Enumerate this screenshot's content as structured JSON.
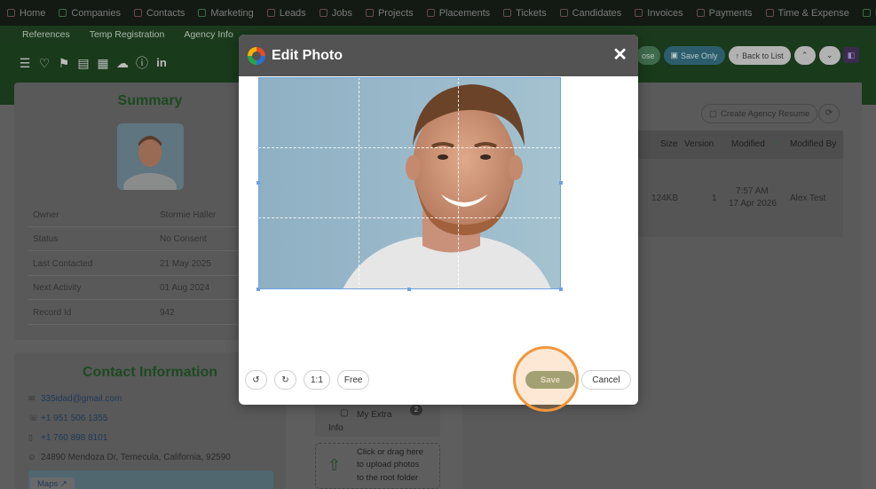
{
  "topnav": {
    "items": [
      "Home",
      "Companies",
      "Contacts",
      "Marketing",
      "Leads",
      "Jobs",
      "Projects",
      "Placements",
      "Tickets",
      "Candidates",
      "Invoices",
      "Payments",
      "Time & Expense",
      "R"
    ]
  },
  "subnav": {
    "items": [
      "References",
      "Temp Registration",
      "Agency Info"
    ]
  },
  "toolbar": {
    "partial_button_label": "ose",
    "save_only_label": "Save Only",
    "back_label": "Back to List",
    "up_label": "⌃",
    "down_label": "⌄"
  },
  "summary": {
    "title": "Summary",
    "fields": [
      {
        "label": "Owner",
        "value": "Stormie Haller"
      },
      {
        "label": "Status",
        "value": "No Consent"
      },
      {
        "label": "Last Contacted",
        "value": "21 May 2025"
      },
      {
        "label": "Next Activity",
        "value": "01 Aug 2024"
      },
      {
        "label": "Record Id",
        "value": "942"
      }
    ]
  },
  "contact": {
    "title": "Contact Information",
    "email": "335idad@gmail.com",
    "phone1": "+1 951 506 1355",
    "phone2": "+1 760 898 8101",
    "address": "24890 Mendoza Dr, Temecula, California, 92590",
    "maps_label": "Maps"
  },
  "files": {
    "create_resume_label": "Create Agency Resume",
    "columns": {
      "size": "Size",
      "version": "Version",
      "modified": "Modified",
      "modified_by": "Modified By"
    },
    "row": {
      "size": "124KB",
      "version": "1",
      "modified_time": "7:57 AM",
      "modified_date": "17 Apr 2026",
      "modified_by": "Alex Test"
    }
  },
  "extra_info": {
    "label_line1": "My Extra",
    "label_line2": "Info",
    "badge": "2"
  },
  "dropzone": {
    "line1": "Click or drag here",
    "line2": "to upload photos",
    "line3": "to the root folder"
  },
  "modal": {
    "title": "Edit Photo",
    "close_glyph": "✕",
    "tools": {
      "rotate_left": "↺",
      "rotate_right": "↻",
      "ratio_square": "1:1",
      "ratio_free": "Free"
    },
    "save_label": "Save",
    "cancel_label": "Cancel"
  },
  "colors": {
    "accent_green": "#8ea584",
    "highlight": "#f2963a",
    "crop_border": "#6ea0e4"
  }
}
